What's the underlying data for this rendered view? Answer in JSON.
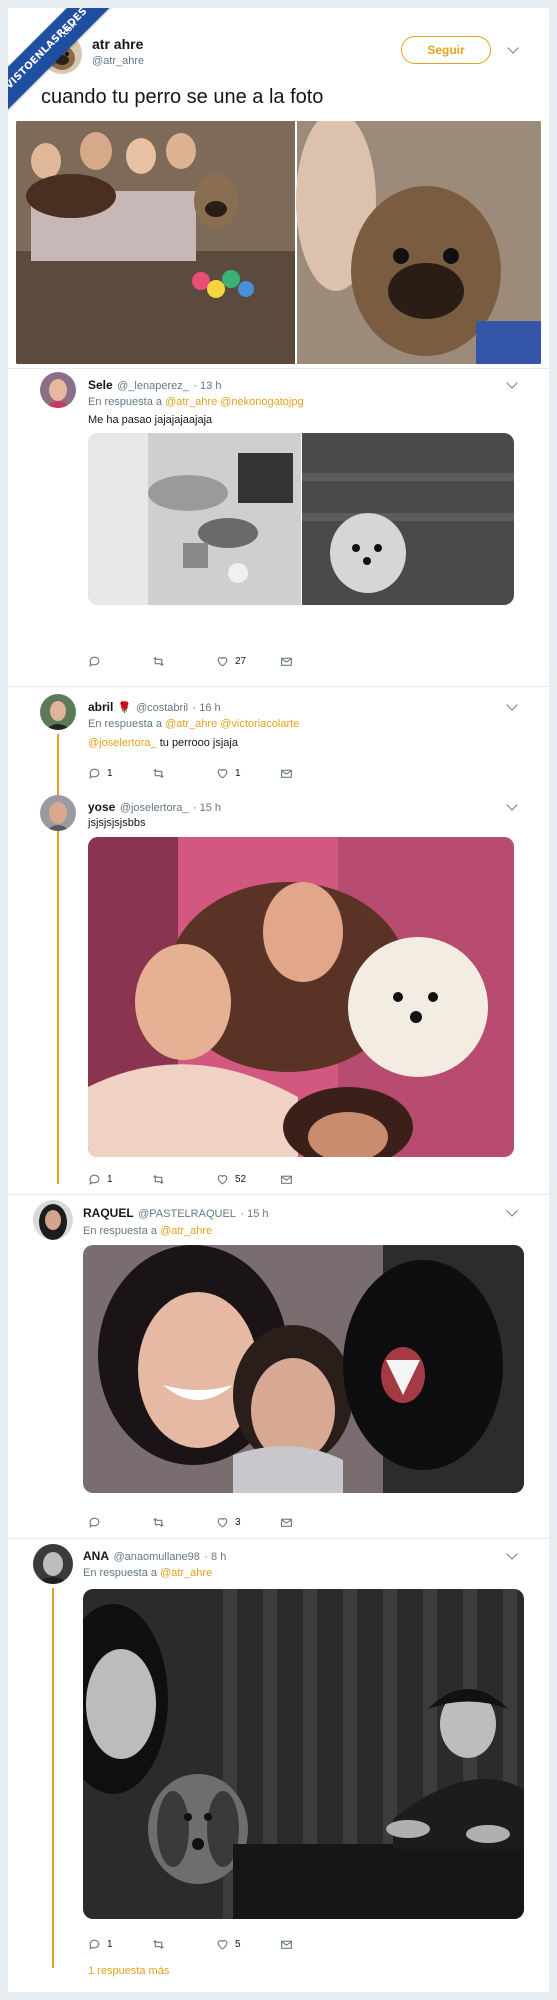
{
  "watermark": {
    "line1": "VISTOENLASREDES",
    "line2": ".COM"
  },
  "main_tweet": {
    "name": "atr ahre",
    "handle": "@atr_ahre",
    "follow_label": "Seguir",
    "text": "cuando tu perro se une a la foto"
  },
  "replies": [
    {
      "name": "Sele",
      "handle": "@_lenaperez_",
      "time": "· 13 h",
      "reply_prefix": "En respuesta a",
      "reply_to": "@atr_ahre @nekonogatojpg",
      "text": "Me ha pasao jajajajaajaja",
      "counts": {
        "reply": "",
        "retweet": "",
        "like": "27"
      }
    },
    {
      "name": "abril",
      "emoji": "🌹",
      "handle": "@costabril",
      "time": "· 16 h",
      "reply_prefix": "En respuesta a",
      "reply_to": "@atr_ahre @victoriacolarte",
      "mention": "@joselertora_",
      "text": " tu perrooo jsjaja",
      "counts": {
        "reply": "1",
        "retweet": "",
        "like": "1"
      }
    },
    {
      "name": "yose",
      "handle": "@joselertora_",
      "time": "· 15 h",
      "text": "jsjsjsjsjsbbs",
      "counts": {
        "reply": "1",
        "retweet": "",
        "like": "52"
      }
    },
    {
      "name": "RAQUEL",
      "handle": "@PASTELRAQUEL",
      "time": "· 15 h",
      "reply_prefix": "En respuesta a",
      "reply_to": "@atr_ahre",
      "counts": {
        "reply": "",
        "retweet": "",
        "like": "3"
      }
    },
    {
      "name": "ANA",
      "handle": "@anaomullane98",
      "time": "· 8 h",
      "reply_prefix": "En respuesta a",
      "reply_to": "@atr_ahre",
      "counts": {
        "reply": "1",
        "retweet": "",
        "like": "5"
      }
    }
  ],
  "more_replies": "1 respuesta más",
  "colors": {
    "accent": "#e1a31f",
    "muted": "#657786",
    "ribbon": "#1f4fa0"
  }
}
